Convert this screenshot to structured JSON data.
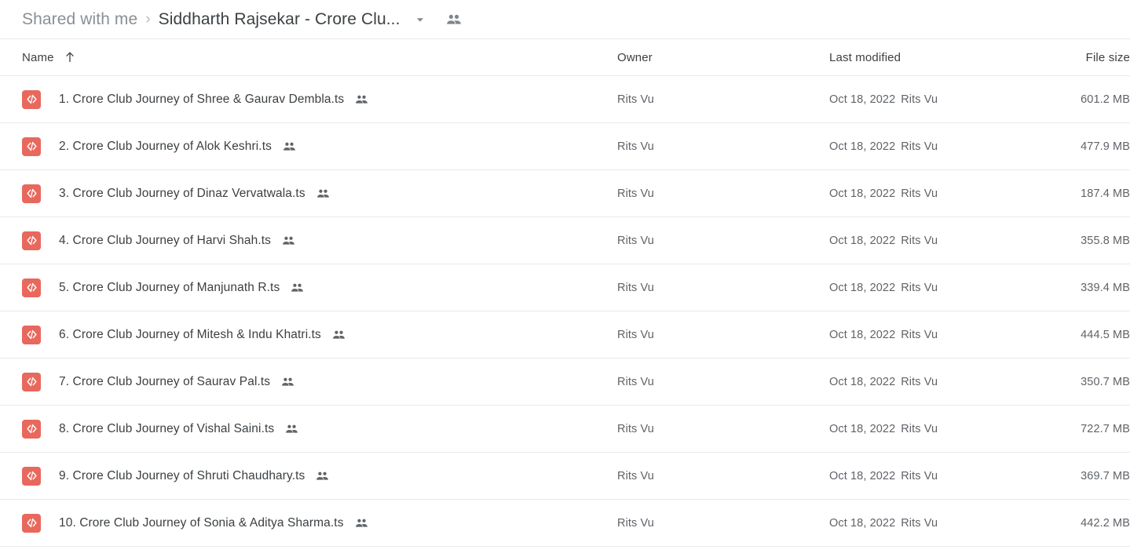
{
  "breadcrumb": {
    "parent": "Shared with me",
    "separator": "›",
    "current": "Siddharth Rajsekar - Crore Clu...",
    "dropdown_icon": "chevron-down-icon",
    "share_icon": "people-icon"
  },
  "columns": {
    "name": "Name",
    "owner": "Owner",
    "modified": "Last modified",
    "size": "File size",
    "sort_icon": "arrow-up-icon",
    "sort_direction": "ascending"
  },
  "colors": {
    "file_icon_bg": "#e8685d",
    "primary_text": "#3c4043",
    "secondary_text": "#5f6368",
    "muted_text": "#8a8f94",
    "divider": "#e8eaed"
  },
  "files": [
    {
      "name": "1. Crore Club Journey of Shree & Gaurav Dembla.ts",
      "icon": "code-file-icon",
      "shared": "people-icon",
      "owner": "Rits Vu",
      "modified_date": "Oct 18, 2022",
      "modified_by": "Rits Vu",
      "size": "601.2 MB"
    },
    {
      "name": "2. Crore Club Journey of Alok Keshri.ts",
      "icon": "code-file-icon",
      "shared": "people-icon",
      "owner": "Rits Vu",
      "modified_date": "Oct 18, 2022",
      "modified_by": "Rits Vu",
      "size": "477.9 MB"
    },
    {
      "name": "3. Crore Club Journey of Dinaz Vervatwala.ts",
      "icon": "code-file-icon",
      "shared": "people-icon",
      "owner": "Rits Vu",
      "modified_date": "Oct 18, 2022",
      "modified_by": "Rits Vu",
      "size": "187.4 MB"
    },
    {
      "name": "4. Crore Club Journey of Harvi Shah.ts",
      "icon": "code-file-icon",
      "shared": "people-icon",
      "owner": "Rits Vu",
      "modified_date": "Oct 18, 2022",
      "modified_by": "Rits Vu",
      "size": "355.8 MB"
    },
    {
      "name": "5. Crore Club Journey of Manjunath R.ts",
      "icon": "code-file-icon",
      "shared": "people-icon",
      "owner": "Rits Vu",
      "modified_date": "Oct 18, 2022",
      "modified_by": "Rits Vu",
      "size": "339.4 MB"
    },
    {
      "name": "6. Crore Club Journey of Mitesh & Indu Khatri.ts",
      "icon": "code-file-icon",
      "shared": "people-icon",
      "owner": "Rits Vu",
      "modified_date": "Oct 18, 2022",
      "modified_by": "Rits Vu",
      "size": "444.5 MB"
    },
    {
      "name": "7. Crore Club Journey of Saurav Pal.ts",
      "icon": "code-file-icon",
      "shared": "people-icon",
      "owner": "Rits Vu",
      "modified_date": "Oct 18, 2022",
      "modified_by": "Rits Vu",
      "size": "350.7 MB"
    },
    {
      "name": "8. Crore Club Journey of Vishal Saini.ts",
      "icon": "code-file-icon",
      "shared": "people-icon",
      "owner": "Rits Vu",
      "modified_date": "Oct 18, 2022",
      "modified_by": "Rits Vu",
      "size": "722.7 MB"
    },
    {
      "name": "9. Crore Club Journey of Shruti Chaudhary.ts",
      "icon": "code-file-icon",
      "shared": "people-icon",
      "owner": "Rits Vu",
      "modified_date": "Oct 18, 2022",
      "modified_by": "Rits Vu",
      "size": "369.7 MB"
    },
    {
      "name": "10. Crore Club Journey of Sonia & Aditya Sharma.ts",
      "icon": "code-file-icon",
      "shared": "people-icon",
      "owner": "Rits Vu",
      "modified_date": "Oct 18, 2022",
      "modified_by": "Rits Vu",
      "size": "442.2 MB"
    }
  ]
}
